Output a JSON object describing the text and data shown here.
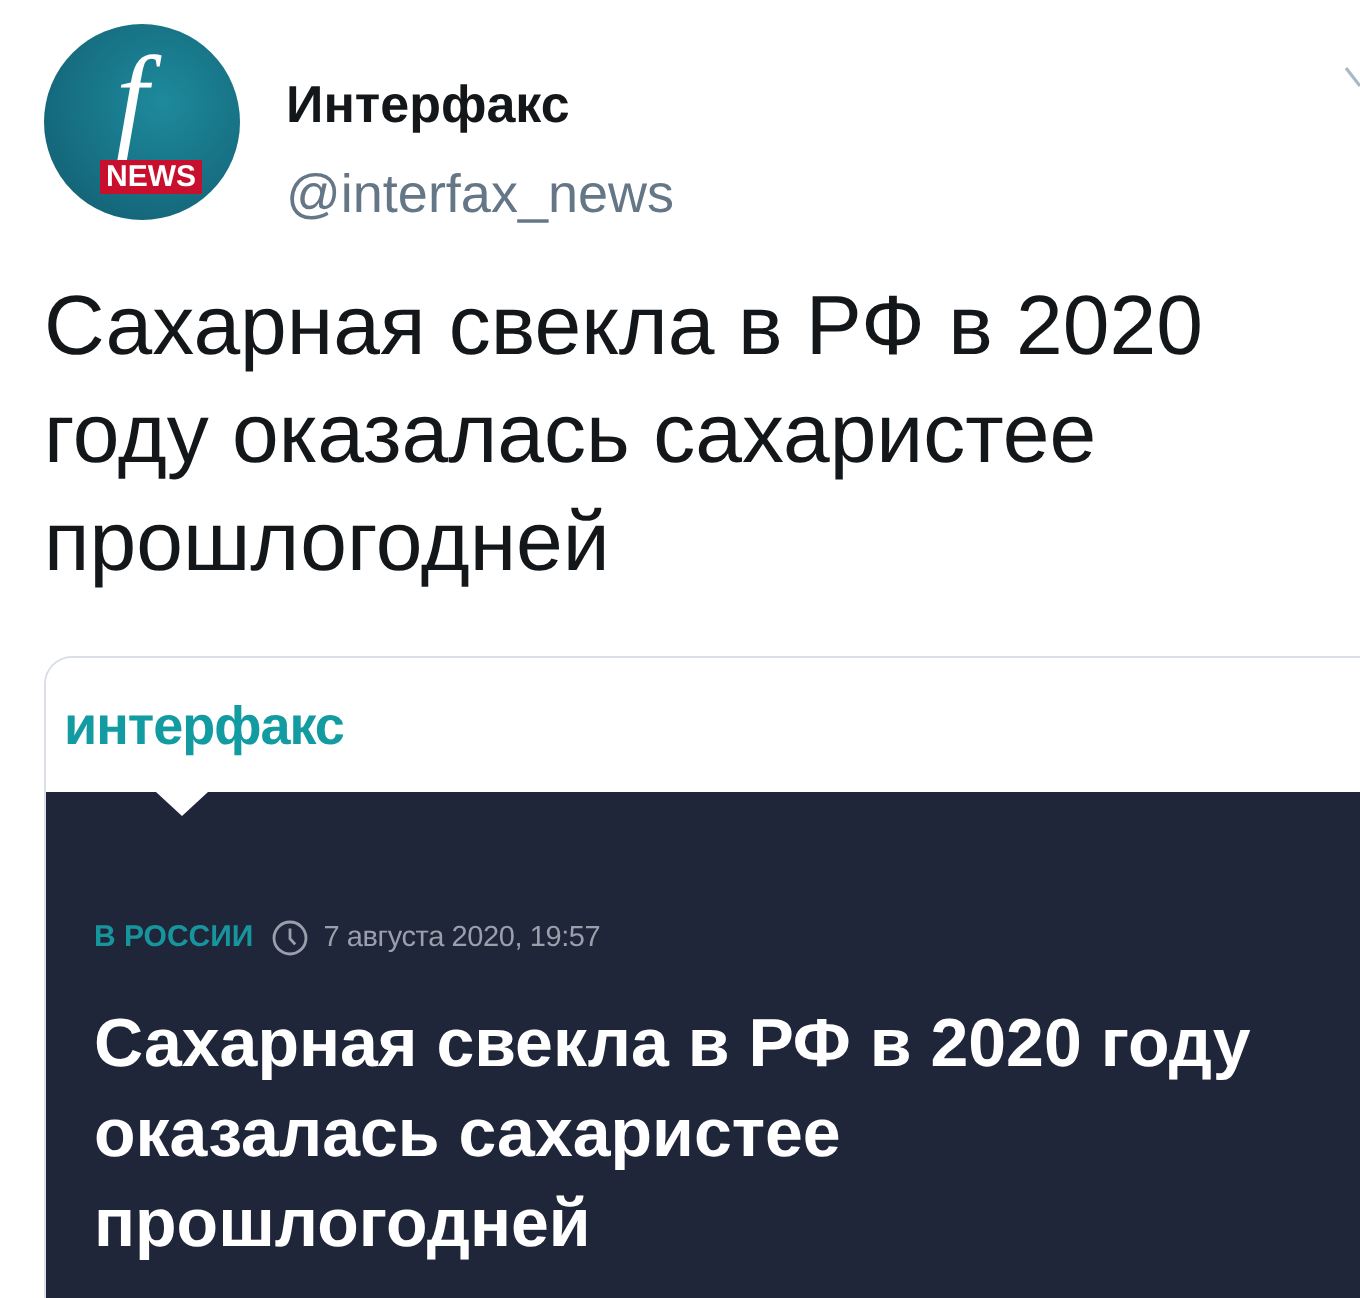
{
  "tweet": {
    "author": {
      "avatar": {
        "letter": "f",
        "badge": "NEWS"
      },
      "name": "Интерфакс",
      "handle": "@interfax_news"
    },
    "text": "Сахарная свекла в РФ в 2020 году оказалась сахаристее прошлогодней",
    "card": {
      "logo": "интерфакс",
      "section": "В РОССИИ",
      "date": "7 августа 2020, 19:57",
      "headline": "Сахарная свекла в РФ в 2020 году оказалась сахаристее прошлогодней"
    }
  }
}
